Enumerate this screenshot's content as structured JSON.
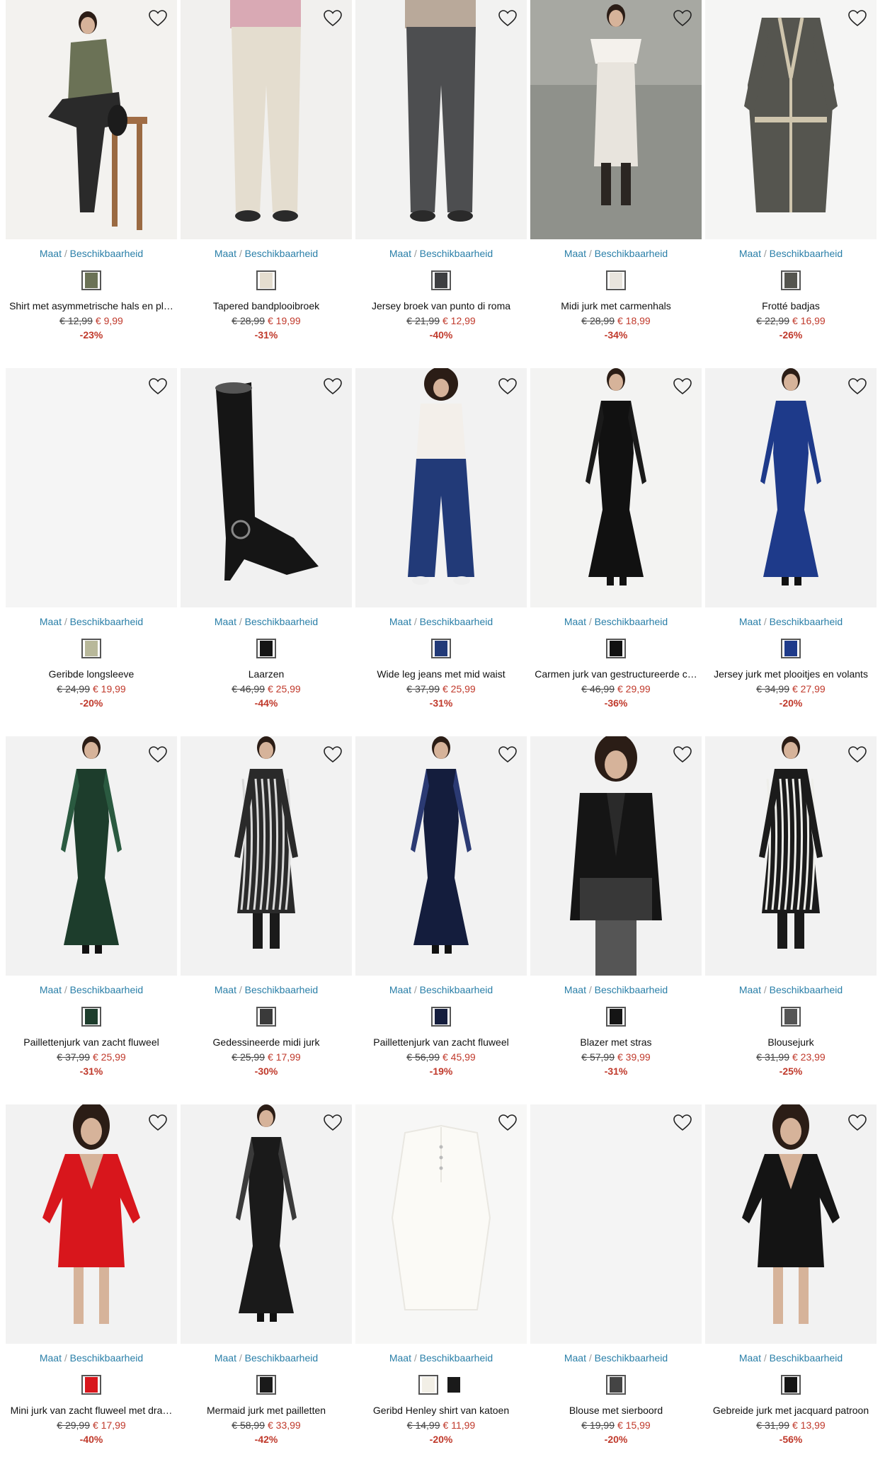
{
  "size_link": {
    "maat": "Maat",
    "sep": "/",
    "availability": "Beschikbaarheid"
  },
  "products": [
    {
      "title": "Shirt met asymmetrische hals en pl…",
      "old_price": "€ 12,99",
      "new_price": "€ 9,99",
      "discount": "-23%",
      "bg": "#f3f2ef",
      "figure": "woman-sitting",
      "colors": [
        "#6b7256",
        "#2a2a2a"
      ],
      "swatches": [
        "#6b7256"
      ]
    },
    {
      "title": "Tapered bandplooibroek",
      "old_price": "€ 28,99",
      "new_price": "€ 19,99",
      "discount": "-31%",
      "bg": "#f1f0ee",
      "figure": "trousers",
      "colors": [
        "#e4ddcf",
        "#d9a9b4"
      ],
      "swatches": [
        "#e4ddcf"
      ]
    },
    {
      "title": "Jersey broek van punto di roma",
      "old_price": "€ 21,99",
      "new_price": "€ 12,99",
      "discount": "-40%",
      "bg": "#f2f2f1",
      "figure": "trousers",
      "colors": [
        "#4d4e50",
        "#b9a99a"
      ],
      "swatches": [
        "#3e3f41"
      ]
    },
    {
      "title": "Midi jurk met carmenhals",
      "old_price": "€ 28,99",
      "new_price": "€ 18,99",
      "discount": "-34%",
      "bg": "#9b9c96",
      "figure": "dress-back",
      "colors": [
        "#e8e4dd",
        "#2b2622"
      ],
      "swatches": [
        "#e8e4dd"
      ]
    },
    {
      "title": "Frotté badjas",
      "old_price": "€ 22,99",
      "new_price": "€ 16,99",
      "discount": "-26%",
      "bg": "#f5f5f4",
      "figure": "robe",
      "colors": [
        "#55554f",
        "#cfc5ad"
      ],
      "swatches": [
        "#55554f"
      ]
    },
    {
      "title": "Geribde longsleeve",
      "old_price": "€ 24,99",
      "new_price": "€ 19,99",
      "discount": "-20%",
      "bg": "#f5f5f5",
      "figure": "none",
      "colors": [
        "#f5f5f5",
        "#f5f5f5"
      ],
      "swatches": [
        "#b8b89a"
      ]
    },
    {
      "title": "Laarzen",
      "old_price": "€ 46,99",
      "new_price": "€ 25,99",
      "discount": "-44%",
      "bg": "#f1f1f1",
      "figure": "boot",
      "colors": [
        "#151515",
        "#555555"
      ],
      "swatches": [
        "#151515"
      ]
    },
    {
      "title": "Wide leg jeans met mid waist",
      "old_price": "€ 37,99",
      "new_price": "€ 25,99",
      "discount": "-31%",
      "bg": "#f2f2f2",
      "figure": "woman-jeans",
      "colors": [
        "#223a78",
        "#f3efea"
      ],
      "swatches": [
        "#223a78"
      ]
    },
    {
      "title": "Carmen jurk van gestructureerde c…",
      "old_price": "€ 46,99",
      "new_price": "€ 29,99",
      "discount": "-36%",
      "bg": "#f3f3f2",
      "figure": "gown",
      "colors": [
        "#111111",
        "#1a1a1a"
      ],
      "swatches": [
        "#111111"
      ]
    },
    {
      "title": "Jersey jurk met plooitjes en volants",
      "old_price": "€ 34,99",
      "new_price": "€ 27,99",
      "discount": "-20%",
      "bg": "#f2f2f2",
      "figure": "gown",
      "colors": [
        "#1e3a8a",
        "#1e3a8a"
      ],
      "swatches": [
        "#1e3a8a"
      ]
    },
    {
      "title": "Paillettenjurk van zacht fluweel",
      "old_price": "€ 37,99",
      "new_price": "€ 25,99",
      "discount": "-31%",
      "bg": "#f2f2f2",
      "figure": "gown",
      "colors": [
        "#1d3d2c",
        "#2a5a40"
      ],
      "swatches": [
        "#1d3d2c"
      ]
    },
    {
      "title": "Gedessineerde midi jurk",
      "old_price": "€ 25,99",
      "new_price": "€ 17,99",
      "discount": "-30%",
      "bg": "#f2f2f2",
      "figure": "dress-midi",
      "colors": [
        "#2a2a2a",
        "#d9d9d9"
      ],
      "swatches": [
        "#3a3a3a"
      ]
    },
    {
      "title": "Paillettenjurk van zacht fluweel",
      "old_price": "€ 56,99",
      "new_price": "€ 45,99",
      "discount": "-19%",
      "bg": "#f2f2f2",
      "figure": "gown",
      "colors": [
        "#141d3d",
        "#2b3a73"
      ],
      "swatches": [
        "#141d3d"
      ]
    },
    {
      "title": "Blazer met stras",
      "old_price": "€ 57,99",
      "new_price": "€ 39,99",
      "discount": "-31%",
      "bg": "#f2f2f2",
      "figure": "blazer",
      "colors": [
        "#151515",
        "#5b5b5b"
      ],
      "swatches": [
        "#151515"
      ]
    },
    {
      "title": "Blousejurk",
      "old_price": "€ 31,99",
      "new_price": "€ 23,99",
      "discount": "-25%",
      "bg": "#f2f2f2",
      "figure": "dress-midi",
      "colors": [
        "#1b1b1b",
        "#eeeeea"
      ],
      "swatches": [
        "#555555"
      ]
    },
    {
      "title": "Mini jurk van zacht fluweel met dra…",
      "old_price": "€ 29,99",
      "new_price": "€ 17,99",
      "discount": "-40%",
      "bg": "#f2f2f2",
      "figure": "dress-short",
      "colors": [
        "#d8161c",
        "#d8161c"
      ],
      "swatches": [
        "#d8161c"
      ]
    },
    {
      "title": "Mermaid jurk met pailletten",
      "old_price": "€ 58,99",
      "new_price": "€ 33,99",
      "discount": "-42%",
      "bg": "#f2f2f2",
      "figure": "gown",
      "colors": [
        "#1a1a1a",
        "#3a3a3a"
      ],
      "swatches": [
        "#1a1a1a"
      ]
    },
    {
      "title": "Geribd Henley shirt van katoen",
      "old_price": "€ 14,99",
      "new_price": "€ 11,99",
      "discount": "-20%",
      "bg": "#f7f7f6",
      "figure": "shirt",
      "colors": [
        "#fbfaf6",
        "#e9e7e1"
      ],
      "swatches": [
        "#f2efe6",
        "#1a1a1a"
      ]
    },
    {
      "title": "Blouse met sierboord",
      "old_price": "€ 19,99",
      "new_price": "€ 15,99",
      "discount": "-20%",
      "bg": "#f4f4f4",
      "figure": "none",
      "colors": [
        "#f4f4f4",
        "#f4f4f4"
      ],
      "swatches": [
        "#444444"
      ]
    },
    {
      "title": "Gebreide jurk met jacquard patroon",
      "old_price": "€ 31,99",
      "new_price": "€ 13,99",
      "discount": "-56%",
      "bg": "#f2f2f2",
      "figure": "dress-short",
      "colors": [
        "#141414",
        "#f2f2f2"
      ],
      "swatches": [
        "#141414"
      ]
    }
  ]
}
